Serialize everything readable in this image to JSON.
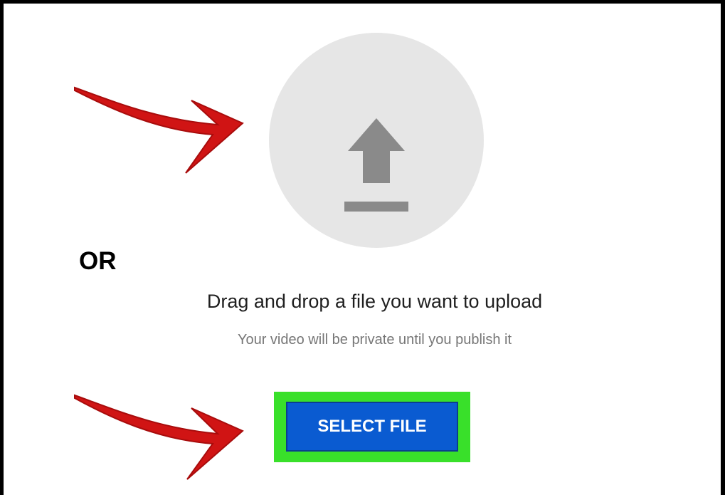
{
  "upload": {
    "or_label": "OR",
    "title": "Drag and drop a file you want to upload",
    "subtitle": "Your video will be private until you publish it",
    "select_file_label": "SELECT FILE",
    "icon": "upload-icon"
  },
  "colors": {
    "circle_bg": "#e6e6e6",
    "icon_gray": "#8a8a8a",
    "button_blue": "#0a5bd1",
    "highlight_green": "#39e02a",
    "arrow_red": "#d01414"
  }
}
